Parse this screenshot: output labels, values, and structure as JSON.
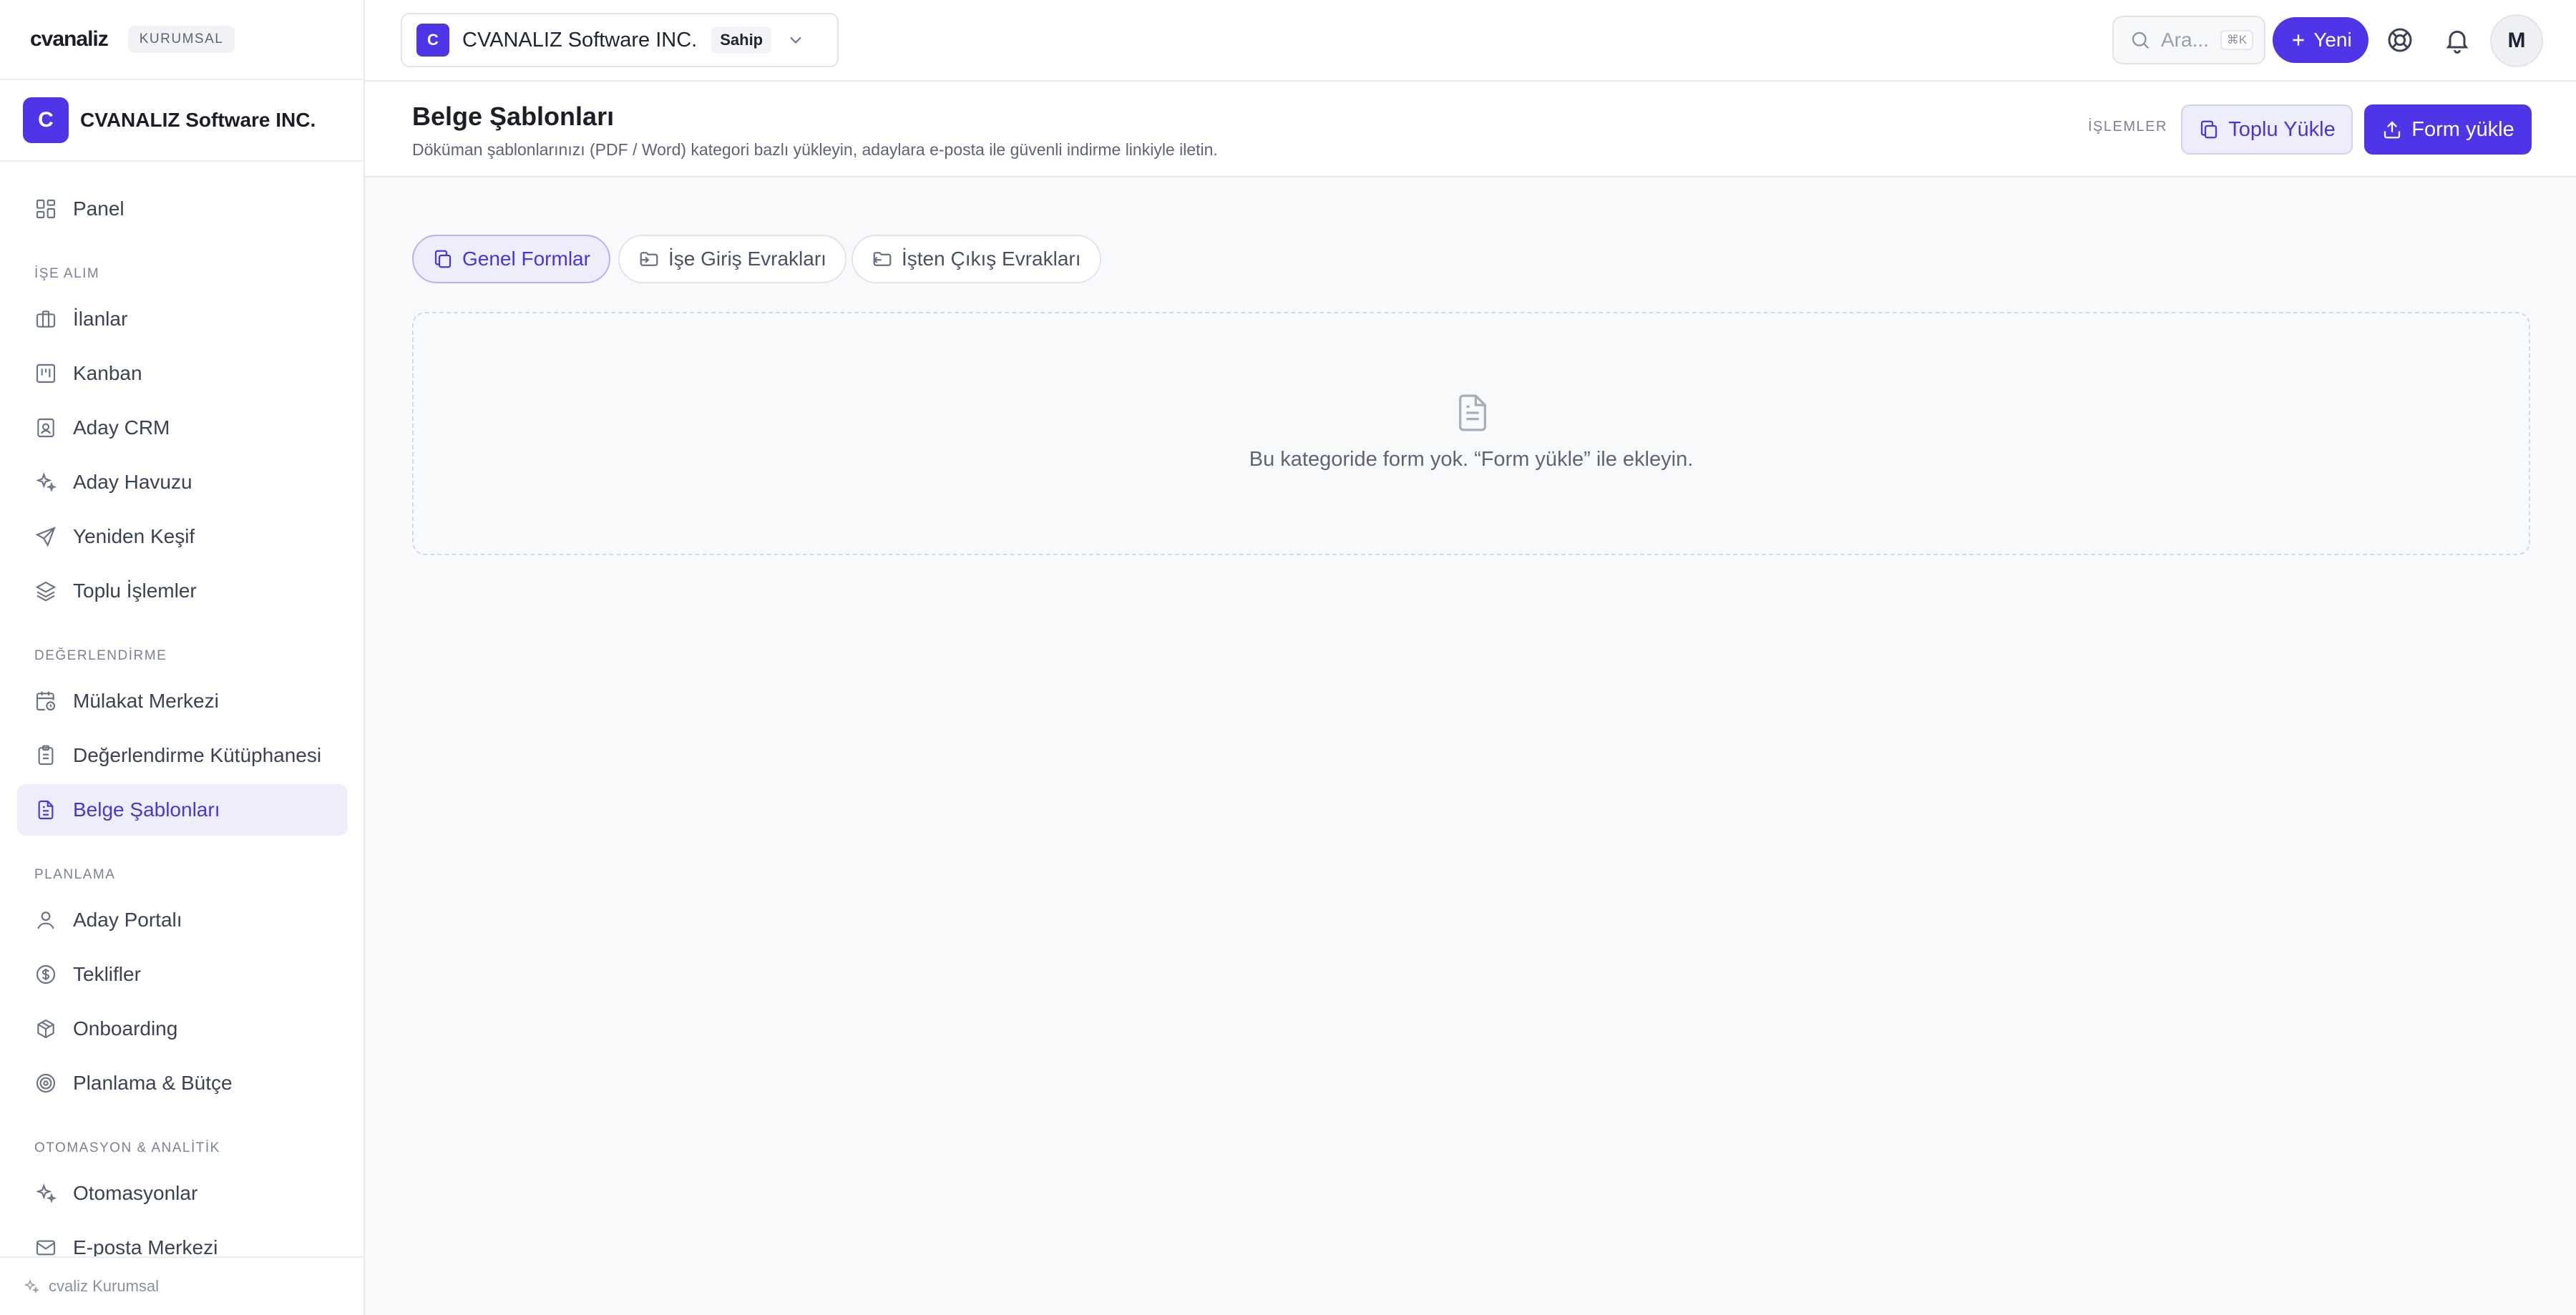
{
  "brand": {
    "logo": "cvanaliz",
    "badge": "KURUMSAL"
  },
  "org": {
    "initial": "C",
    "name": "CVANALIZ Software INC."
  },
  "sidebar": {
    "panel": "Panel",
    "section_hiring": "İŞE ALIM",
    "ilanlar": "İlanlar",
    "kanban": "Kanban",
    "aday_crm": "Aday CRM",
    "aday_havuzu": "Aday Havuzu",
    "yeniden_kesif": "Yeniden Keşif",
    "toplu_islemler": "Toplu İşlemler",
    "section_eval": "DEĞERLENDİRME",
    "mulakat": "Mülakat Merkezi",
    "degerlendirme_kutuphanesi": "Değerlendirme Kütüphanesi",
    "belge_sablonlari": "Belge Şablonları",
    "section_planning": "PLANLAMA",
    "aday_portali": "Aday Portalı",
    "teklifler": "Teklifler",
    "onboarding": "Onboarding",
    "planlama_butce": "Planlama & Bütçe",
    "section_automation": "OTOMASYON & ANALİTİK",
    "otomasyonlar": "Otomasyonlar",
    "eposta_merkezi": "E-posta Merkezi",
    "footer": "cvaliz Kurumsal"
  },
  "topbar": {
    "workspace_initial": "C",
    "workspace_name": "CVANALIZ Software INC.",
    "workspace_role": "Sahip",
    "search_placeholder": "Ara...",
    "search_shortcut": "⌘K",
    "new_label": "Yeni",
    "user_initial": "M"
  },
  "header": {
    "title": "Belge Şablonları",
    "subtitle": "Döküman şablonlarınızı (PDF / Word) kategori bazlı yükleyin, adaylara e-posta ile güvenli indirme linkiyle iletin.",
    "actions_label": "İŞLEMLER",
    "bulk_upload": "Toplu Yükle",
    "form_upload": "Form yükle"
  },
  "tabs": {
    "general": "Genel Formlar",
    "onboarding_docs": "İşe Giriş Evrakları",
    "offboarding_docs": "İşten Çıkış Evrakları"
  },
  "empty_state": {
    "message": "Bu kategoride form yok. “Form yükle” ile ekleyin."
  },
  "colors": {
    "accent": "#4f35e8",
    "accent_soft": "#eeedfc"
  }
}
